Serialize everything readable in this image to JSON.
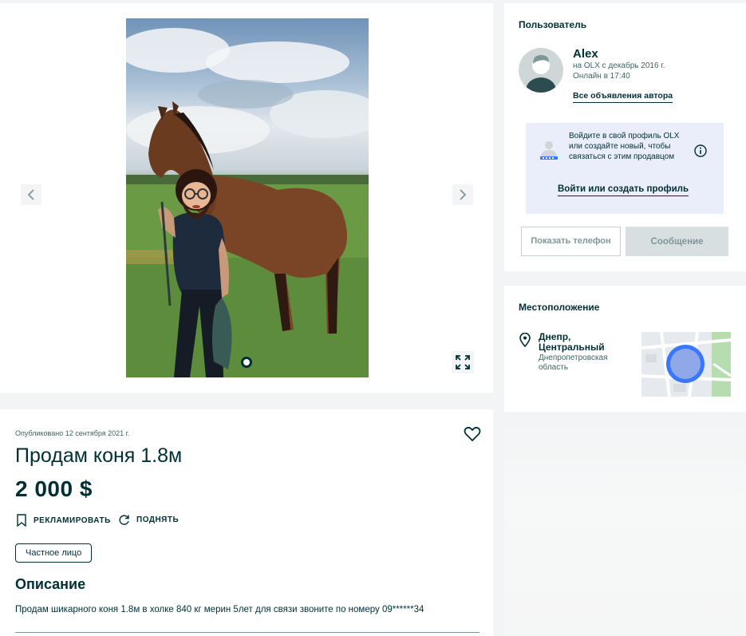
{
  "gallery": {
    "photo_alt": "",
    "slide_index": 1
  },
  "ad": {
    "published": "Опубликовано 12 сентября 2021 г.",
    "title": "Продам коня 1.8м",
    "price": "2 000 $",
    "promote_label": "РЕКЛАМИРОВАТЬ",
    "raise_label": "ПОДНЯТЬ",
    "seller_type": "Частное лицо",
    "description_heading": "Описание",
    "description": "Продам шикарного коня 1.8м в холке 840 кг мерин 5лет для связи звоните по номеру 09******34"
  },
  "user": {
    "heading": "Пользователь",
    "name": "Alex",
    "since": "на OLX с декабрь 2016 г.",
    "online": "Онлайн в 17:40",
    "all_ads_link": "Все объявления автора",
    "login_prompt": "Войдите в свой профиль OLX или создайте новый, чтобы связаться с этим продавцом",
    "login_button": "Войти или создать профиль",
    "show_phone": "Показать телефон",
    "message": "Сообщение"
  },
  "location": {
    "heading": "Местоположение",
    "city": "Днепр, Центральный",
    "region": "Днепропетровская область"
  },
  "colors": {
    "brand": "#002f34",
    "muted": "#406367",
    "login_box": "#eaeefb",
    "map_marker": "#3a77ff"
  },
  "icons": {
    "prev": "chevron-left-icon",
    "next": "chevron-right-icon",
    "expand": "expand-icon",
    "favorite": "heart-icon",
    "promote": "bookmark-icon",
    "raise": "refresh-icon",
    "info": "info-icon",
    "location": "map-pin-icon"
  }
}
